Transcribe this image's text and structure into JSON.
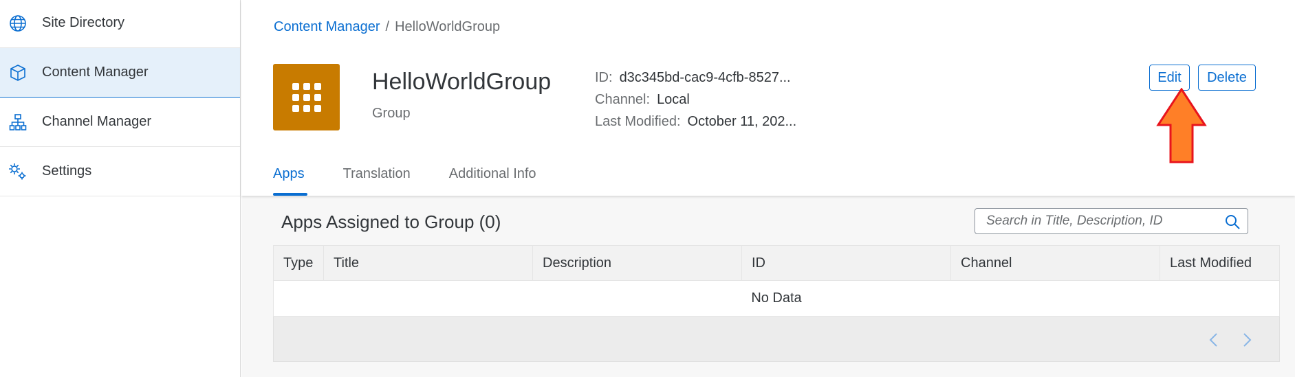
{
  "sidebar": {
    "items": [
      {
        "label": "Site Directory",
        "icon": "globe-icon",
        "active": false
      },
      {
        "label": "Content Manager",
        "icon": "cube-icon",
        "active": true
      },
      {
        "label": "Channel Manager",
        "icon": "hierarchy-icon",
        "active": false
      },
      {
        "label": "Settings",
        "icon": "gears-icon",
        "active": false
      }
    ]
  },
  "breadcrumb": {
    "link": "Content Manager",
    "separator": "/",
    "current": "HelloWorldGroup"
  },
  "object": {
    "title": "HelloWorldGroup",
    "subtitle": "Group",
    "avatar_icon": "app-grid-icon",
    "avatar_color": "#c87b00",
    "attributes": [
      {
        "label": "ID:",
        "value": "d3c345bd-cac9-4cfb-8527..."
      },
      {
        "label": "Channel:",
        "value": "Local"
      },
      {
        "label": "Last Modified:",
        "value": "October 11, 202..."
      }
    ]
  },
  "actions": {
    "edit": "Edit",
    "delete": "Delete"
  },
  "tabs": [
    {
      "label": "Apps",
      "active": true
    },
    {
      "label": "Translation",
      "active": false
    },
    {
      "label": "Additional Info",
      "active": false
    }
  ],
  "content": {
    "title": "Apps Assigned to Group (0)",
    "search_placeholder": "Search in Title, Description, ID",
    "columns": [
      "Type",
      "Title",
      "Description",
      "ID",
      "Channel",
      "Last Modified"
    ],
    "no_data": "No Data"
  },
  "colors": {
    "accent": "#0a6ed1",
    "annotation_arrow": "#ff7f27"
  }
}
